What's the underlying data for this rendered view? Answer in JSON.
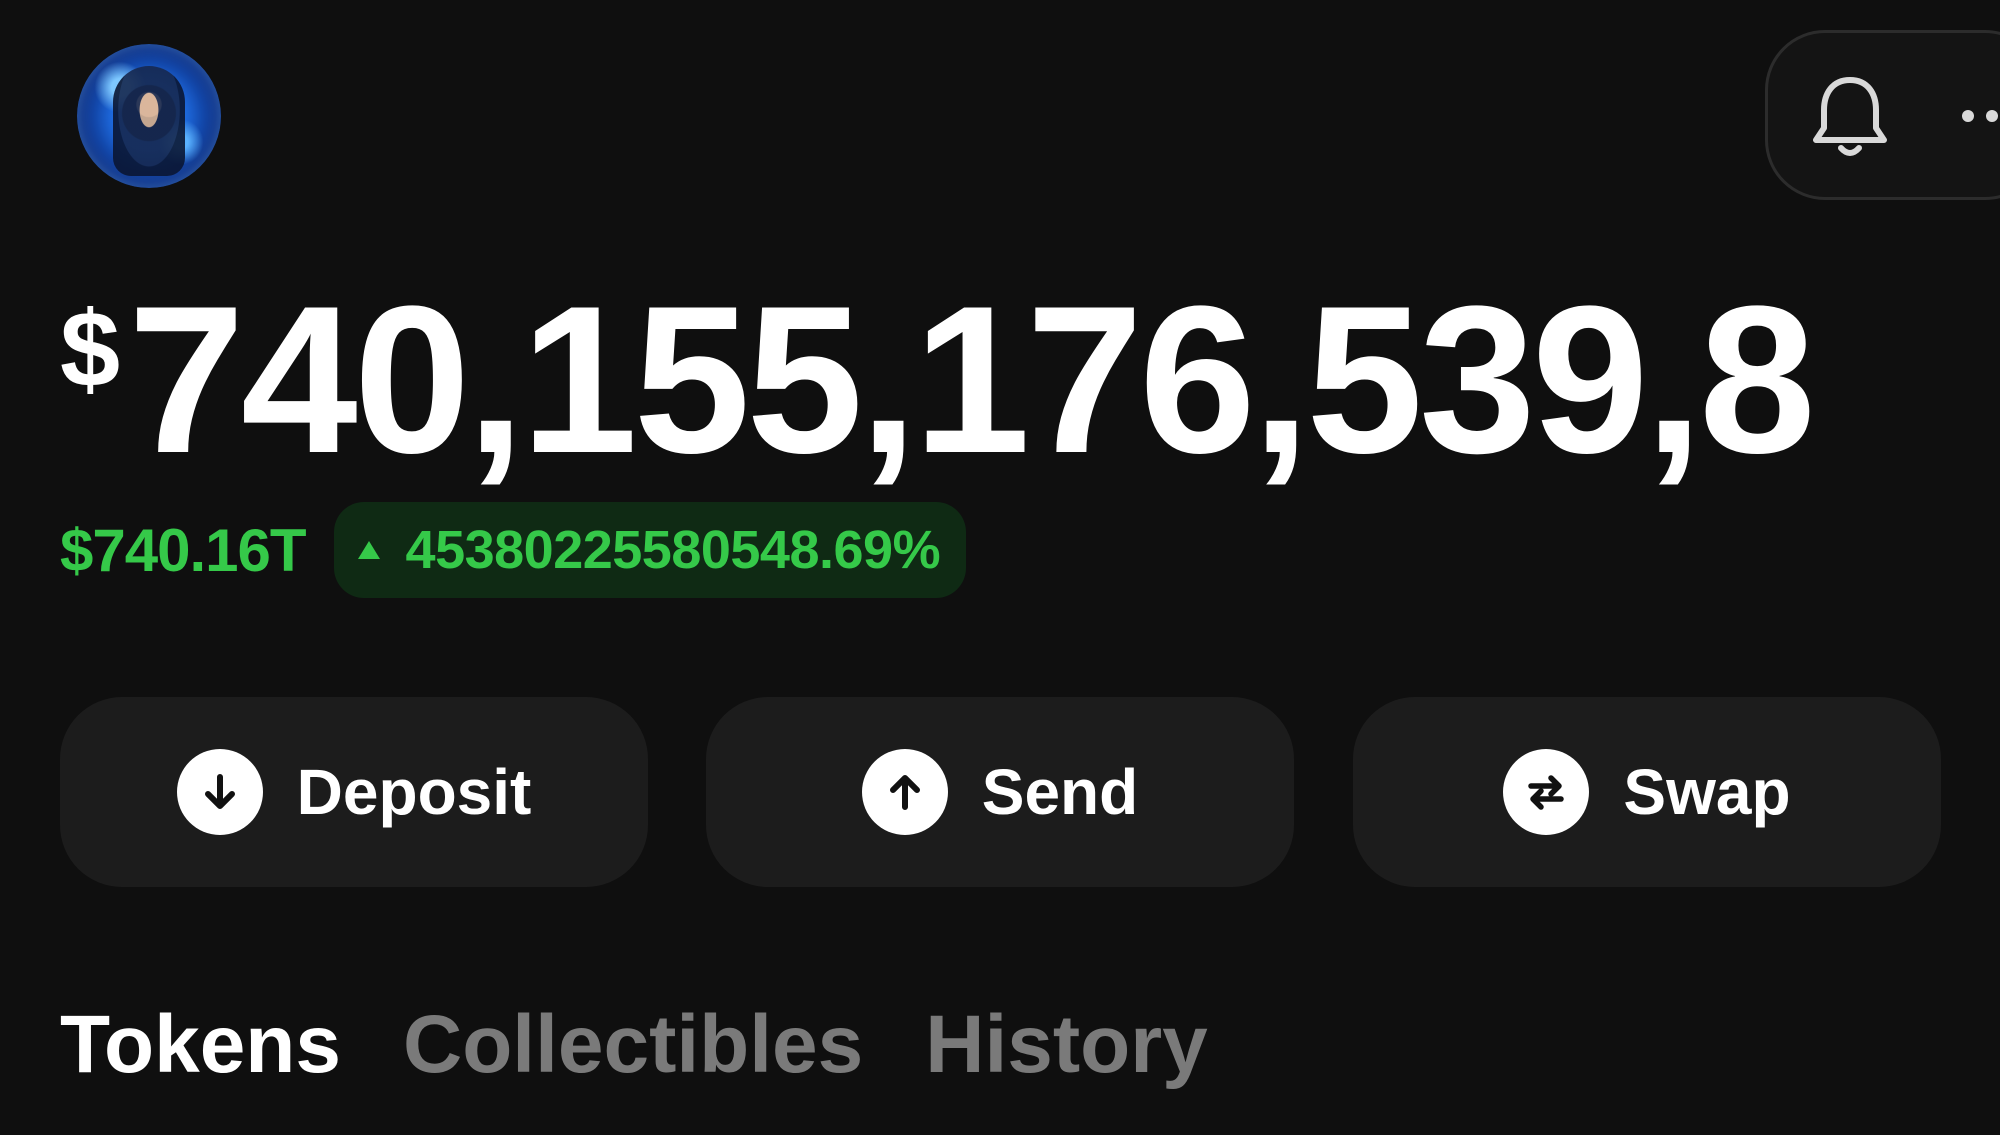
{
  "header": {
    "avatar_icon": "profile-avatar-hooded-figure",
    "notification_icon": "bell-icon",
    "more_icon": "more-horizontal-icon"
  },
  "balance": {
    "currency_symbol": "$",
    "amount": "740,155,176,539,8"
  },
  "change": {
    "value": "$740.16T",
    "direction_icon": "triangle-up-icon",
    "percent": "45380225580548.69%",
    "color": "#35c949",
    "badge_color": "#0f2a14"
  },
  "actions": [
    {
      "label": "Deposit",
      "icon": "arrow-down-icon"
    },
    {
      "label": "Send",
      "icon": "arrow-up-icon"
    },
    {
      "label": "Swap",
      "icon": "swap-arrows-icon"
    }
  ],
  "tabs": [
    {
      "label": "Tokens",
      "active": true
    },
    {
      "label": "Collectibles",
      "active": false
    },
    {
      "label": "History",
      "active": false
    }
  ],
  "colors": {
    "background": "#0f0f0f",
    "button_bg": "#1c1c1c",
    "text_primary": "#ffffff",
    "text_muted": "#7a7a7a",
    "positive": "#35c949"
  }
}
